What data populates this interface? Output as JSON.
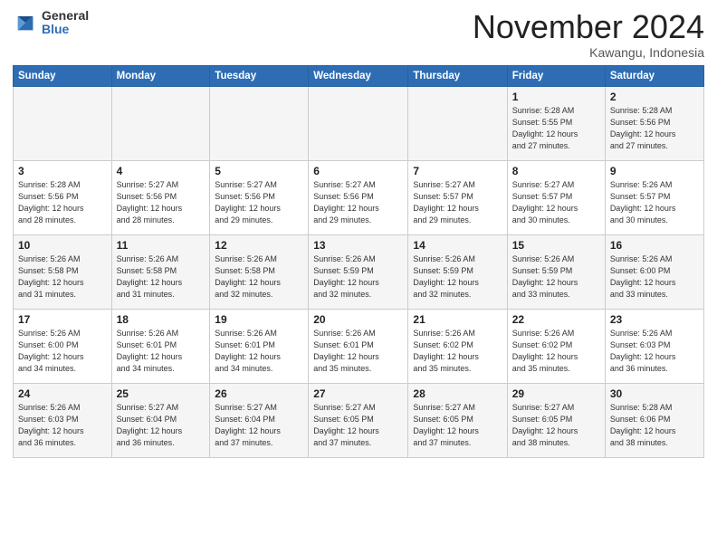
{
  "header": {
    "logo_general": "General",
    "logo_blue": "Blue",
    "month": "November 2024",
    "location": "Kawangu, Indonesia"
  },
  "weekdays": [
    "Sunday",
    "Monday",
    "Tuesday",
    "Wednesday",
    "Thursday",
    "Friday",
    "Saturday"
  ],
  "weeks": [
    [
      {
        "day": "",
        "info": ""
      },
      {
        "day": "",
        "info": ""
      },
      {
        "day": "",
        "info": ""
      },
      {
        "day": "",
        "info": ""
      },
      {
        "day": "",
        "info": ""
      },
      {
        "day": "1",
        "info": "Sunrise: 5:28 AM\nSunset: 5:55 PM\nDaylight: 12 hours\nand 27 minutes."
      },
      {
        "day": "2",
        "info": "Sunrise: 5:28 AM\nSunset: 5:56 PM\nDaylight: 12 hours\nand 27 minutes."
      }
    ],
    [
      {
        "day": "3",
        "info": "Sunrise: 5:28 AM\nSunset: 5:56 PM\nDaylight: 12 hours\nand 28 minutes."
      },
      {
        "day": "4",
        "info": "Sunrise: 5:27 AM\nSunset: 5:56 PM\nDaylight: 12 hours\nand 28 minutes."
      },
      {
        "day": "5",
        "info": "Sunrise: 5:27 AM\nSunset: 5:56 PM\nDaylight: 12 hours\nand 29 minutes."
      },
      {
        "day": "6",
        "info": "Sunrise: 5:27 AM\nSunset: 5:56 PM\nDaylight: 12 hours\nand 29 minutes."
      },
      {
        "day": "7",
        "info": "Sunrise: 5:27 AM\nSunset: 5:57 PM\nDaylight: 12 hours\nand 29 minutes."
      },
      {
        "day": "8",
        "info": "Sunrise: 5:27 AM\nSunset: 5:57 PM\nDaylight: 12 hours\nand 30 minutes."
      },
      {
        "day": "9",
        "info": "Sunrise: 5:26 AM\nSunset: 5:57 PM\nDaylight: 12 hours\nand 30 minutes."
      }
    ],
    [
      {
        "day": "10",
        "info": "Sunrise: 5:26 AM\nSunset: 5:58 PM\nDaylight: 12 hours\nand 31 minutes."
      },
      {
        "day": "11",
        "info": "Sunrise: 5:26 AM\nSunset: 5:58 PM\nDaylight: 12 hours\nand 31 minutes."
      },
      {
        "day": "12",
        "info": "Sunrise: 5:26 AM\nSunset: 5:58 PM\nDaylight: 12 hours\nand 32 minutes."
      },
      {
        "day": "13",
        "info": "Sunrise: 5:26 AM\nSunset: 5:59 PM\nDaylight: 12 hours\nand 32 minutes."
      },
      {
        "day": "14",
        "info": "Sunrise: 5:26 AM\nSunset: 5:59 PM\nDaylight: 12 hours\nand 32 minutes."
      },
      {
        "day": "15",
        "info": "Sunrise: 5:26 AM\nSunset: 5:59 PM\nDaylight: 12 hours\nand 33 minutes."
      },
      {
        "day": "16",
        "info": "Sunrise: 5:26 AM\nSunset: 6:00 PM\nDaylight: 12 hours\nand 33 minutes."
      }
    ],
    [
      {
        "day": "17",
        "info": "Sunrise: 5:26 AM\nSunset: 6:00 PM\nDaylight: 12 hours\nand 34 minutes."
      },
      {
        "day": "18",
        "info": "Sunrise: 5:26 AM\nSunset: 6:01 PM\nDaylight: 12 hours\nand 34 minutes."
      },
      {
        "day": "19",
        "info": "Sunrise: 5:26 AM\nSunset: 6:01 PM\nDaylight: 12 hours\nand 34 minutes."
      },
      {
        "day": "20",
        "info": "Sunrise: 5:26 AM\nSunset: 6:01 PM\nDaylight: 12 hours\nand 35 minutes."
      },
      {
        "day": "21",
        "info": "Sunrise: 5:26 AM\nSunset: 6:02 PM\nDaylight: 12 hours\nand 35 minutes."
      },
      {
        "day": "22",
        "info": "Sunrise: 5:26 AM\nSunset: 6:02 PM\nDaylight: 12 hours\nand 35 minutes."
      },
      {
        "day": "23",
        "info": "Sunrise: 5:26 AM\nSunset: 6:03 PM\nDaylight: 12 hours\nand 36 minutes."
      }
    ],
    [
      {
        "day": "24",
        "info": "Sunrise: 5:26 AM\nSunset: 6:03 PM\nDaylight: 12 hours\nand 36 minutes."
      },
      {
        "day": "25",
        "info": "Sunrise: 5:27 AM\nSunset: 6:04 PM\nDaylight: 12 hours\nand 36 minutes."
      },
      {
        "day": "26",
        "info": "Sunrise: 5:27 AM\nSunset: 6:04 PM\nDaylight: 12 hours\nand 37 minutes."
      },
      {
        "day": "27",
        "info": "Sunrise: 5:27 AM\nSunset: 6:05 PM\nDaylight: 12 hours\nand 37 minutes."
      },
      {
        "day": "28",
        "info": "Sunrise: 5:27 AM\nSunset: 6:05 PM\nDaylight: 12 hours\nand 37 minutes."
      },
      {
        "day": "29",
        "info": "Sunrise: 5:27 AM\nSunset: 6:05 PM\nDaylight: 12 hours\nand 38 minutes."
      },
      {
        "day": "30",
        "info": "Sunrise: 5:28 AM\nSunset: 6:06 PM\nDaylight: 12 hours\nand 38 minutes."
      }
    ]
  ]
}
